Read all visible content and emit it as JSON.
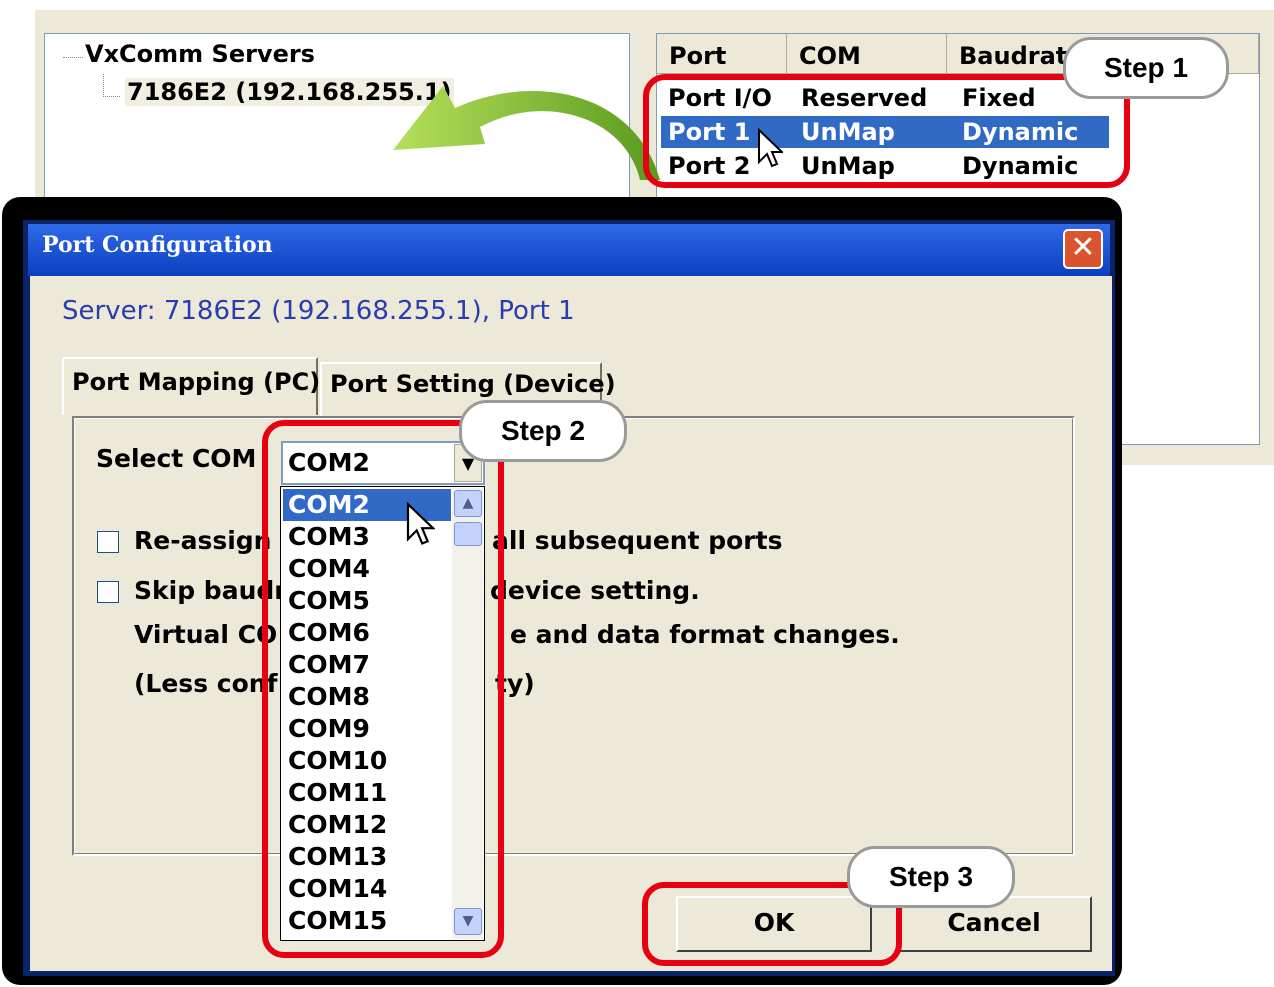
{
  "tree": {
    "root": "VxComm Servers",
    "child": "7186E2 (192.168.255.1)"
  },
  "port_list": {
    "columns": [
      "Port",
      "COM",
      "Baudrat"
    ],
    "rows": [
      {
        "port": "Port I/O",
        "com": "Reserved",
        "baud": "Fixed",
        "selected": false
      },
      {
        "port": "Port 1",
        "com": "UnMap",
        "baud": "Dynamic",
        "selected": true
      },
      {
        "port": "Port 2",
        "com": "UnMap",
        "baud": "Dynamic",
        "selected": false
      }
    ]
  },
  "dialog": {
    "title": "Port Configuration",
    "close_label": "✕",
    "server_info": "Server: 7186E2 (192.168.255.1), Port 1",
    "tabs": [
      "Port Mapping (PC)",
      "Port Setting (Device)"
    ],
    "select_com_label": "Select COM",
    "combo_value": "COM2",
    "com_options": [
      "COM2",
      "COM3",
      "COM4",
      "COM5",
      "COM6",
      "COM7",
      "COM8",
      "COM9",
      "COM10",
      "COM11",
      "COM12",
      "COM13",
      "COM14",
      "COM15"
    ],
    "reassign_visible_start": "Re-assign",
    "reassign_visible_end": "all subsequent ports",
    "skip_visible_start": "Skip baudr",
    "skip_visible_end": "device setting.",
    "virtual_visible_start": "Virtual CO",
    "virtual_visible_end": "e and data format changes.",
    "less_visible_start": "(Less conf",
    "less_visible_end": "ty)",
    "ok_label": "OK",
    "cancel_label": "Cancel"
  },
  "annotations": {
    "step1": "Step 1",
    "step2": "Step 2",
    "step3": "Step 3",
    "highlight_color": "#e60012",
    "arrow_color": "#8cc63f"
  },
  "icons": [
    "mouse-cursor-icon",
    "curved-arrow-icon",
    "dropdown-arrow-icon",
    "scroll-up-icon",
    "scroll-down-icon"
  ]
}
